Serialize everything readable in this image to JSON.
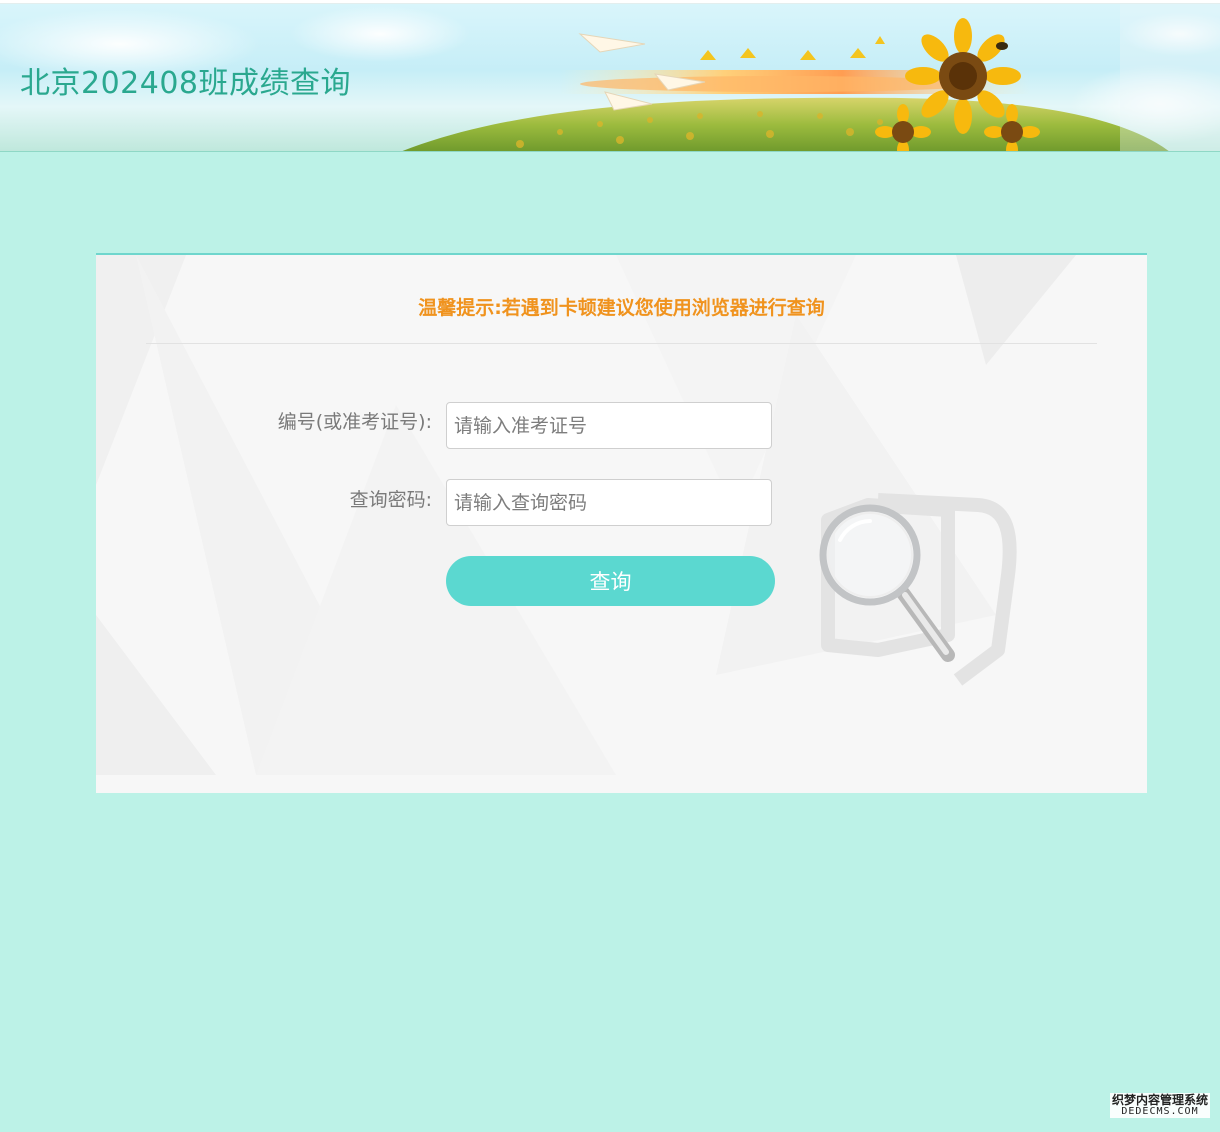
{
  "header": {
    "title": "北京202408班成绩查询"
  },
  "panel": {
    "tip": "温馨提示:若遇到卡顿建议您使用浏览器进行查询",
    "form": {
      "id_label": "编号(或准考证号):",
      "id_placeholder": "请输入准考证号",
      "id_value": "",
      "password_label": "查询密码:",
      "password_placeholder": "请输入查询密码",
      "password_value": "",
      "submit_label": "查询"
    }
  },
  "footer": {
    "watermark_line1": "织梦内容管理系统",
    "watermark_line2": "DEDECMS.COM"
  },
  "colors": {
    "page_bg": "#bcf2e7",
    "title": "#2aa88f",
    "tip": "#f0931e",
    "button": "#5bd8d0",
    "panel_border": "#6fd6cd"
  },
  "icons": {
    "banner": "sunflower-field-banner",
    "magnifier": "magnifying-glass-icon"
  }
}
